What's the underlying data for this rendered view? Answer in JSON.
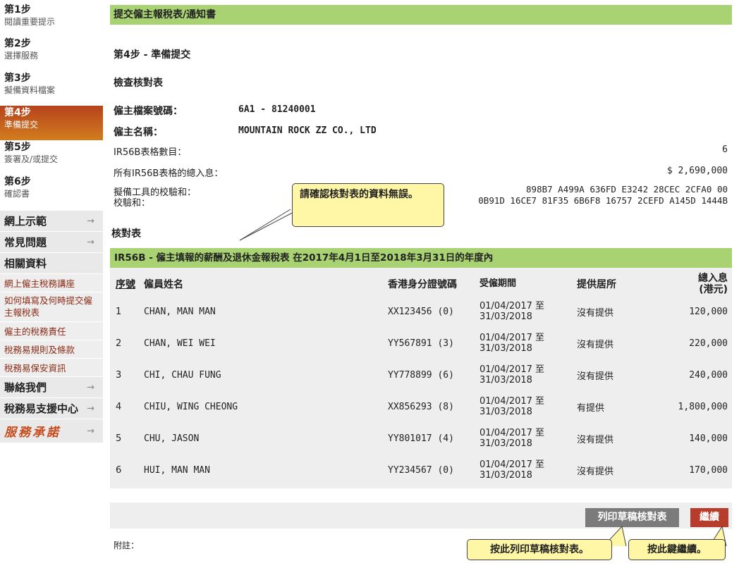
{
  "sidebar": {
    "steps": [
      {
        "title": "第1步",
        "subtitle": "閱讀重要提示"
      },
      {
        "title": "第2步",
        "subtitle": "選擇服務"
      },
      {
        "title": "第3步",
        "subtitle": "擬備資料檔案"
      },
      {
        "title": "第4步",
        "subtitle": "準備提交"
      },
      {
        "title": "第5步",
        "subtitle": "簽署及/或提交"
      },
      {
        "title": "第6步",
        "subtitle": "確認書"
      }
    ],
    "menu": {
      "online_demo": "網上示範",
      "faq": "常見問題",
      "related_info": "相關資料",
      "link_seminar": "網上僱主稅務講座",
      "link_how_to_fill": "如何填寫及何時提交僱主報稅表",
      "link_responsibility": "僱主的稅務責任",
      "link_terms": "稅務易規則及條款",
      "link_security": "稅務易保安資訊",
      "contact_us": "聯絡我們",
      "support_centre": "稅務易支援中心",
      "service_pledge": "服務承諾",
      "arrow": "→"
    }
  },
  "main": {
    "page_title": "提交僱主報稅表/通知書",
    "step_heading": "第4步 - 準備提交",
    "checklist_heading": "檢查核對表",
    "employer_file_label": "僱主檔案號碼：",
    "employer_file_value": "6A1 - 81240001",
    "employer_name_label": "僱主名稱：",
    "employer_name_value": "MOUNTAIN ROCK ZZ CO., LTD",
    "form_count_label": "IR56B表格數目：",
    "form_count_value": "6",
    "total_income_label": "所有IR56B表格的總入息：",
    "total_income_value": "$ 2,690,000",
    "checksum_tool_label": "擬備工具的校驗和：",
    "checksum_tool_value": "898B7 A499A 636FD E3242 28CEC 2CFA0 00",
    "checksum_label": "校驗和：",
    "checksum_value": "0B91D 16CE7 81F35 6B6F8 16757 2CEFD A145D 1444B",
    "hint_verify": "請確認核對表的資料無誤。",
    "checklist_table_label": "核對表"
  },
  "table": {
    "header": "IR56B - 僱主填報的薪酬及退休金報稅表 在2017年4月1日至2018年3月31日的年度內",
    "columns": {
      "no": "序號",
      "name": "僱員姓名",
      "hkid": "香港身分證號碼",
      "period": "受僱期間",
      "quarters": "提供居所",
      "income": "總入息(港元)"
    },
    "rows": [
      {
        "no": "1",
        "name": "CHAN, MAN MAN",
        "hkid": "XX123456 (0)",
        "period_from": "01/04/2017 至",
        "period_to": "31/03/2018",
        "quarters": "沒有提供",
        "income": "120,000"
      },
      {
        "no": "2",
        "name": "CHAN, WEI WEI",
        "hkid": "YY567891 (3)",
        "period_from": "01/04/2017 至",
        "period_to": "31/03/2018",
        "quarters": "沒有提供",
        "income": "220,000"
      },
      {
        "no": "3",
        "name": "CHI, CHAU FUNG",
        "hkid": "YY778899 (6)",
        "period_from": "01/04/2017 至",
        "period_to": "31/03/2018",
        "quarters": "沒有提供",
        "income": "240,000"
      },
      {
        "no": "4",
        "name": "CHIU, WING CHEONG",
        "hkid": "XX856293 (8)",
        "period_from": "01/04/2017 至",
        "period_to": "31/03/2018",
        "quarters": "有提供",
        "income": "1,800,000"
      },
      {
        "no": "5",
        "name": "CHU, JASON",
        "hkid": "YY801017 (4)",
        "period_from": "01/04/2017 至",
        "period_to": "31/03/2018",
        "quarters": "沒有提供",
        "income": "140,000"
      },
      {
        "no": "6",
        "name": "HUI, MAN MAN",
        "hkid": "YY234567 (0)",
        "period_from": "01/04/2017 至",
        "period_to": "31/03/2018",
        "quarters": "沒有提供",
        "income": "170,000"
      }
    ]
  },
  "actions": {
    "print_label": "列印草稿核對表",
    "continue_label": "繼續",
    "hint_print": "按此列印草稿核對表。",
    "hint_continue": "按此鍵繼續。",
    "remarks_label": "附註："
  },
  "colors": {
    "green_bar": "#a9d372",
    "active_step": "#c4591d",
    "continue_button": "#b83c2c",
    "print_button": "#7b7b7b",
    "hint_box": "#fff7a6"
  }
}
